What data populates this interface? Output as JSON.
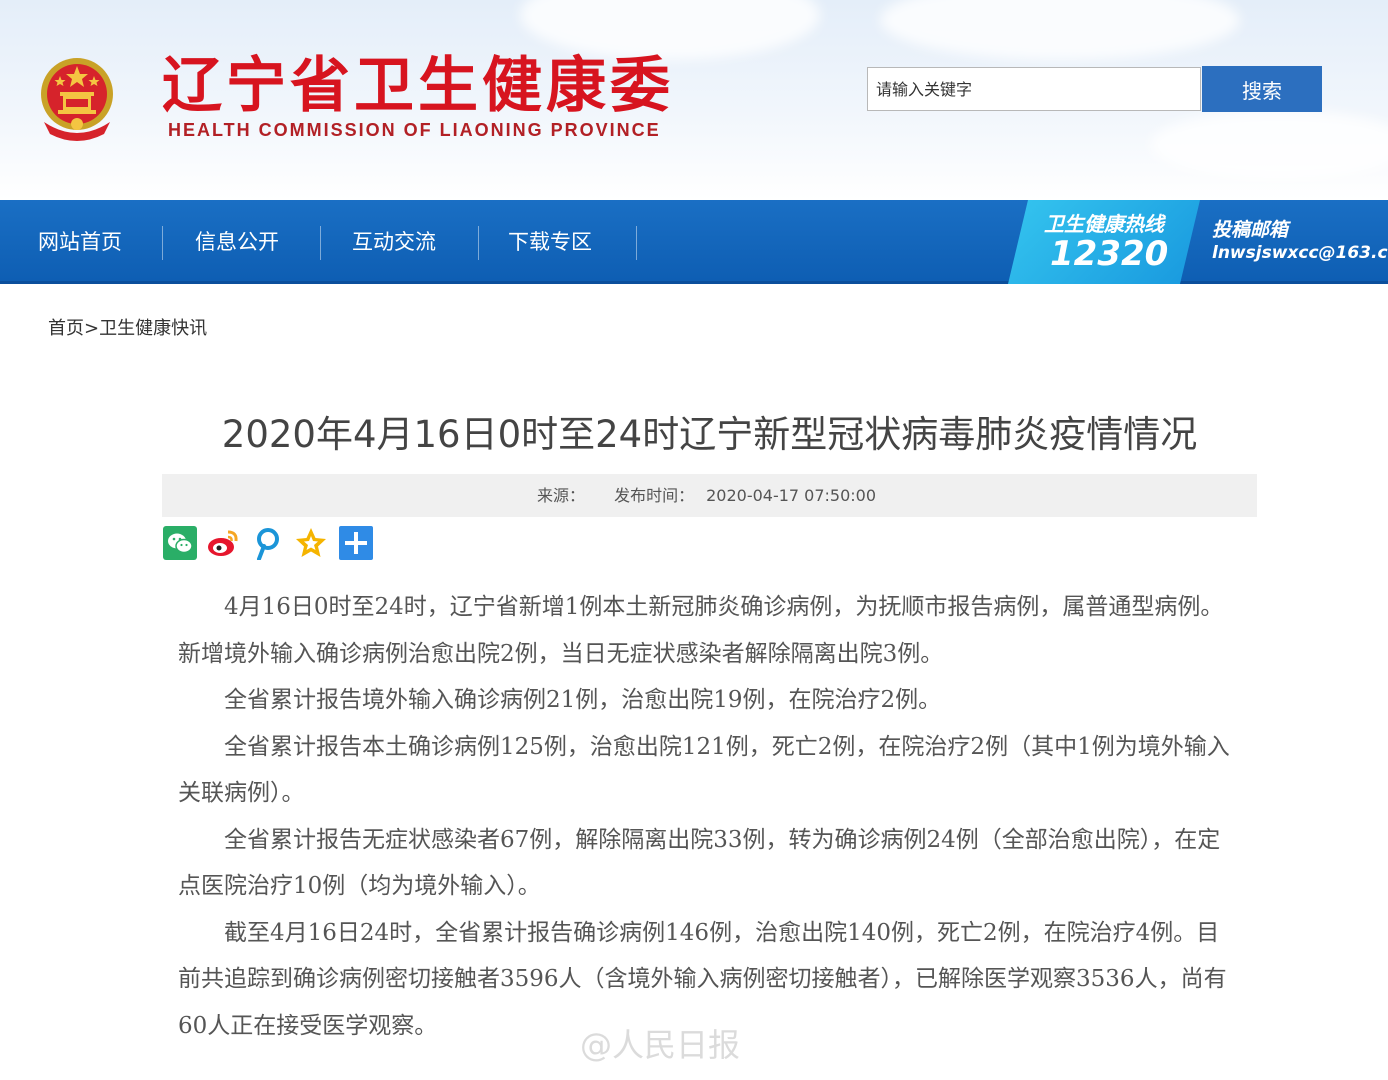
{
  "header": {
    "title": "辽宁省卫生健康委",
    "subtitle": "HEALTH COMMISSION OF LIAONING PROVINCE",
    "search_placeholder": "请输入关键字",
    "search_button": "搜索"
  },
  "nav": {
    "items": [
      {
        "label": "网站首页"
      },
      {
        "label": "信息公开"
      },
      {
        "label": "互动交流"
      },
      {
        "label": "下载专区"
      }
    ],
    "hotline_label": "卫生健康热线",
    "hotline_number": "12320",
    "mailbox_label": "投稿邮箱",
    "mailbox_email": "lnwsjswxcc@163.com"
  },
  "breadcrumb": {
    "home": "首页",
    "separator": ">",
    "current": "卫生健康快讯"
  },
  "article": {
    "title": "2020年4月16日0时至24时辽宁新型冠状病毒肺炎疫情情况",
    "source_label": "来源：",
    "publish_label": "发布时间：",
    "publish_time": "2020-04-17 07:50:00",
    "paragraphs": [
      "4月16日0时至24时，辽宁省新增1例本土新冠肺炎确诊病例，为抚顺市报告病例，属普通型病例。新增境外输入确诊病例治愈出院2例，当日无症状感染者解除隔离出院3例。",
      "全省累计报告境外输入确诊病例21例，治愈出院19例，在院治疗2例。",
      "全省累计报告本土确诊病例125例，治愈出院121例，死亡2例，在院治疗2例（其中1例为境外输入关联病例）。",
      "全省累计报告无症状感染者67例，解除隔离出院33例，转为确诊病例24例（全部治愈出院），在定点医院治疗10例（均为境外输入）。",
      "截至4月16日24时，全省累计报告确诊病例146例，治愈出院140例，死亡2例，在院治疗4例。目前共追踪到确诊病例密切接触者3596人（含境外输入病例密切接触者），已解除医学观察3536人，尚有60人正在接受医学观察。"
    ]
  },
  "share_icons": [
    "wechat-icon",
    "weibo-icon",
    "pinterest-icon",
    "favorite-star-icon",
    "more-plus-icon"
  ],
  "watermark": "@人民日报",
  "colors": {
    "brand_red": "#d7141f",
    "nav_blue": "#1a6fc4",
    "search_button_blue": "#2c6fbf",
    "hotline_cyan": "#35c5ef"
  }
}
